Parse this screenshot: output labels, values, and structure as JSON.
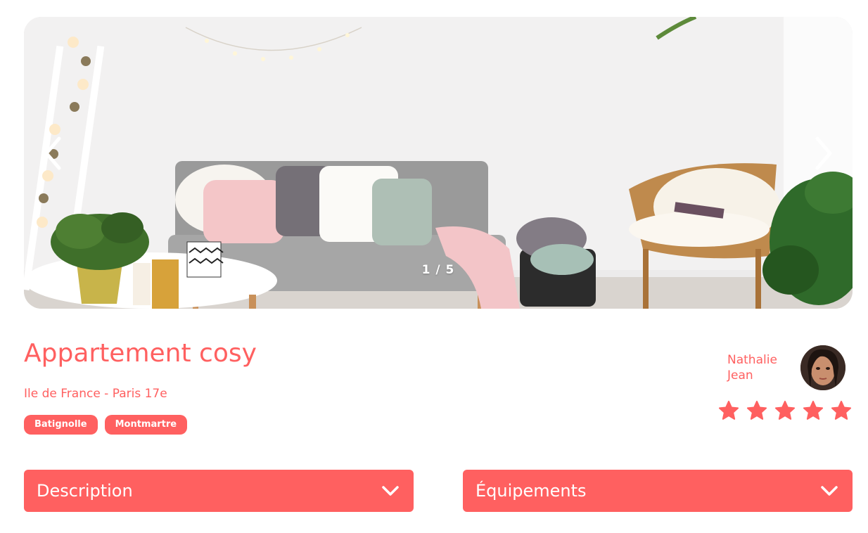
{
  "carousel": {
    "counter": "1 / 5",
    "image_alt": "Living room with grey sofa, cushions, wicker chair and plants",
    "prev_icon": "chevron-left-icon",
    "next_icon": "chevron-right-icon"
  },
  "listing": {
    "title": "Appartement cosy",
    "location": "Ile de France - Paris 17e",
    "tags": [
      "Batignolle",
      "Montmartre"
    ]
  },
  "host": {
    "first_name": "Nathalie",
    "last_name": "Jean"
  },
  "rating": {
    "value": 5,
    "max": 5,
    "icon": "star-icon"
  },
  "collapses": [
    {
      "label": "Description",
      "icon": "chevron-down-icon"
    },
    {
      "label": "Équipements",
      "icon": "chevron-down-icon"
    }
  ],
  "colors": {
    "accent": "#ff6060",
    "star_inactive": "#e3e3e3",
    "white": "#ffffff"
  }
}
